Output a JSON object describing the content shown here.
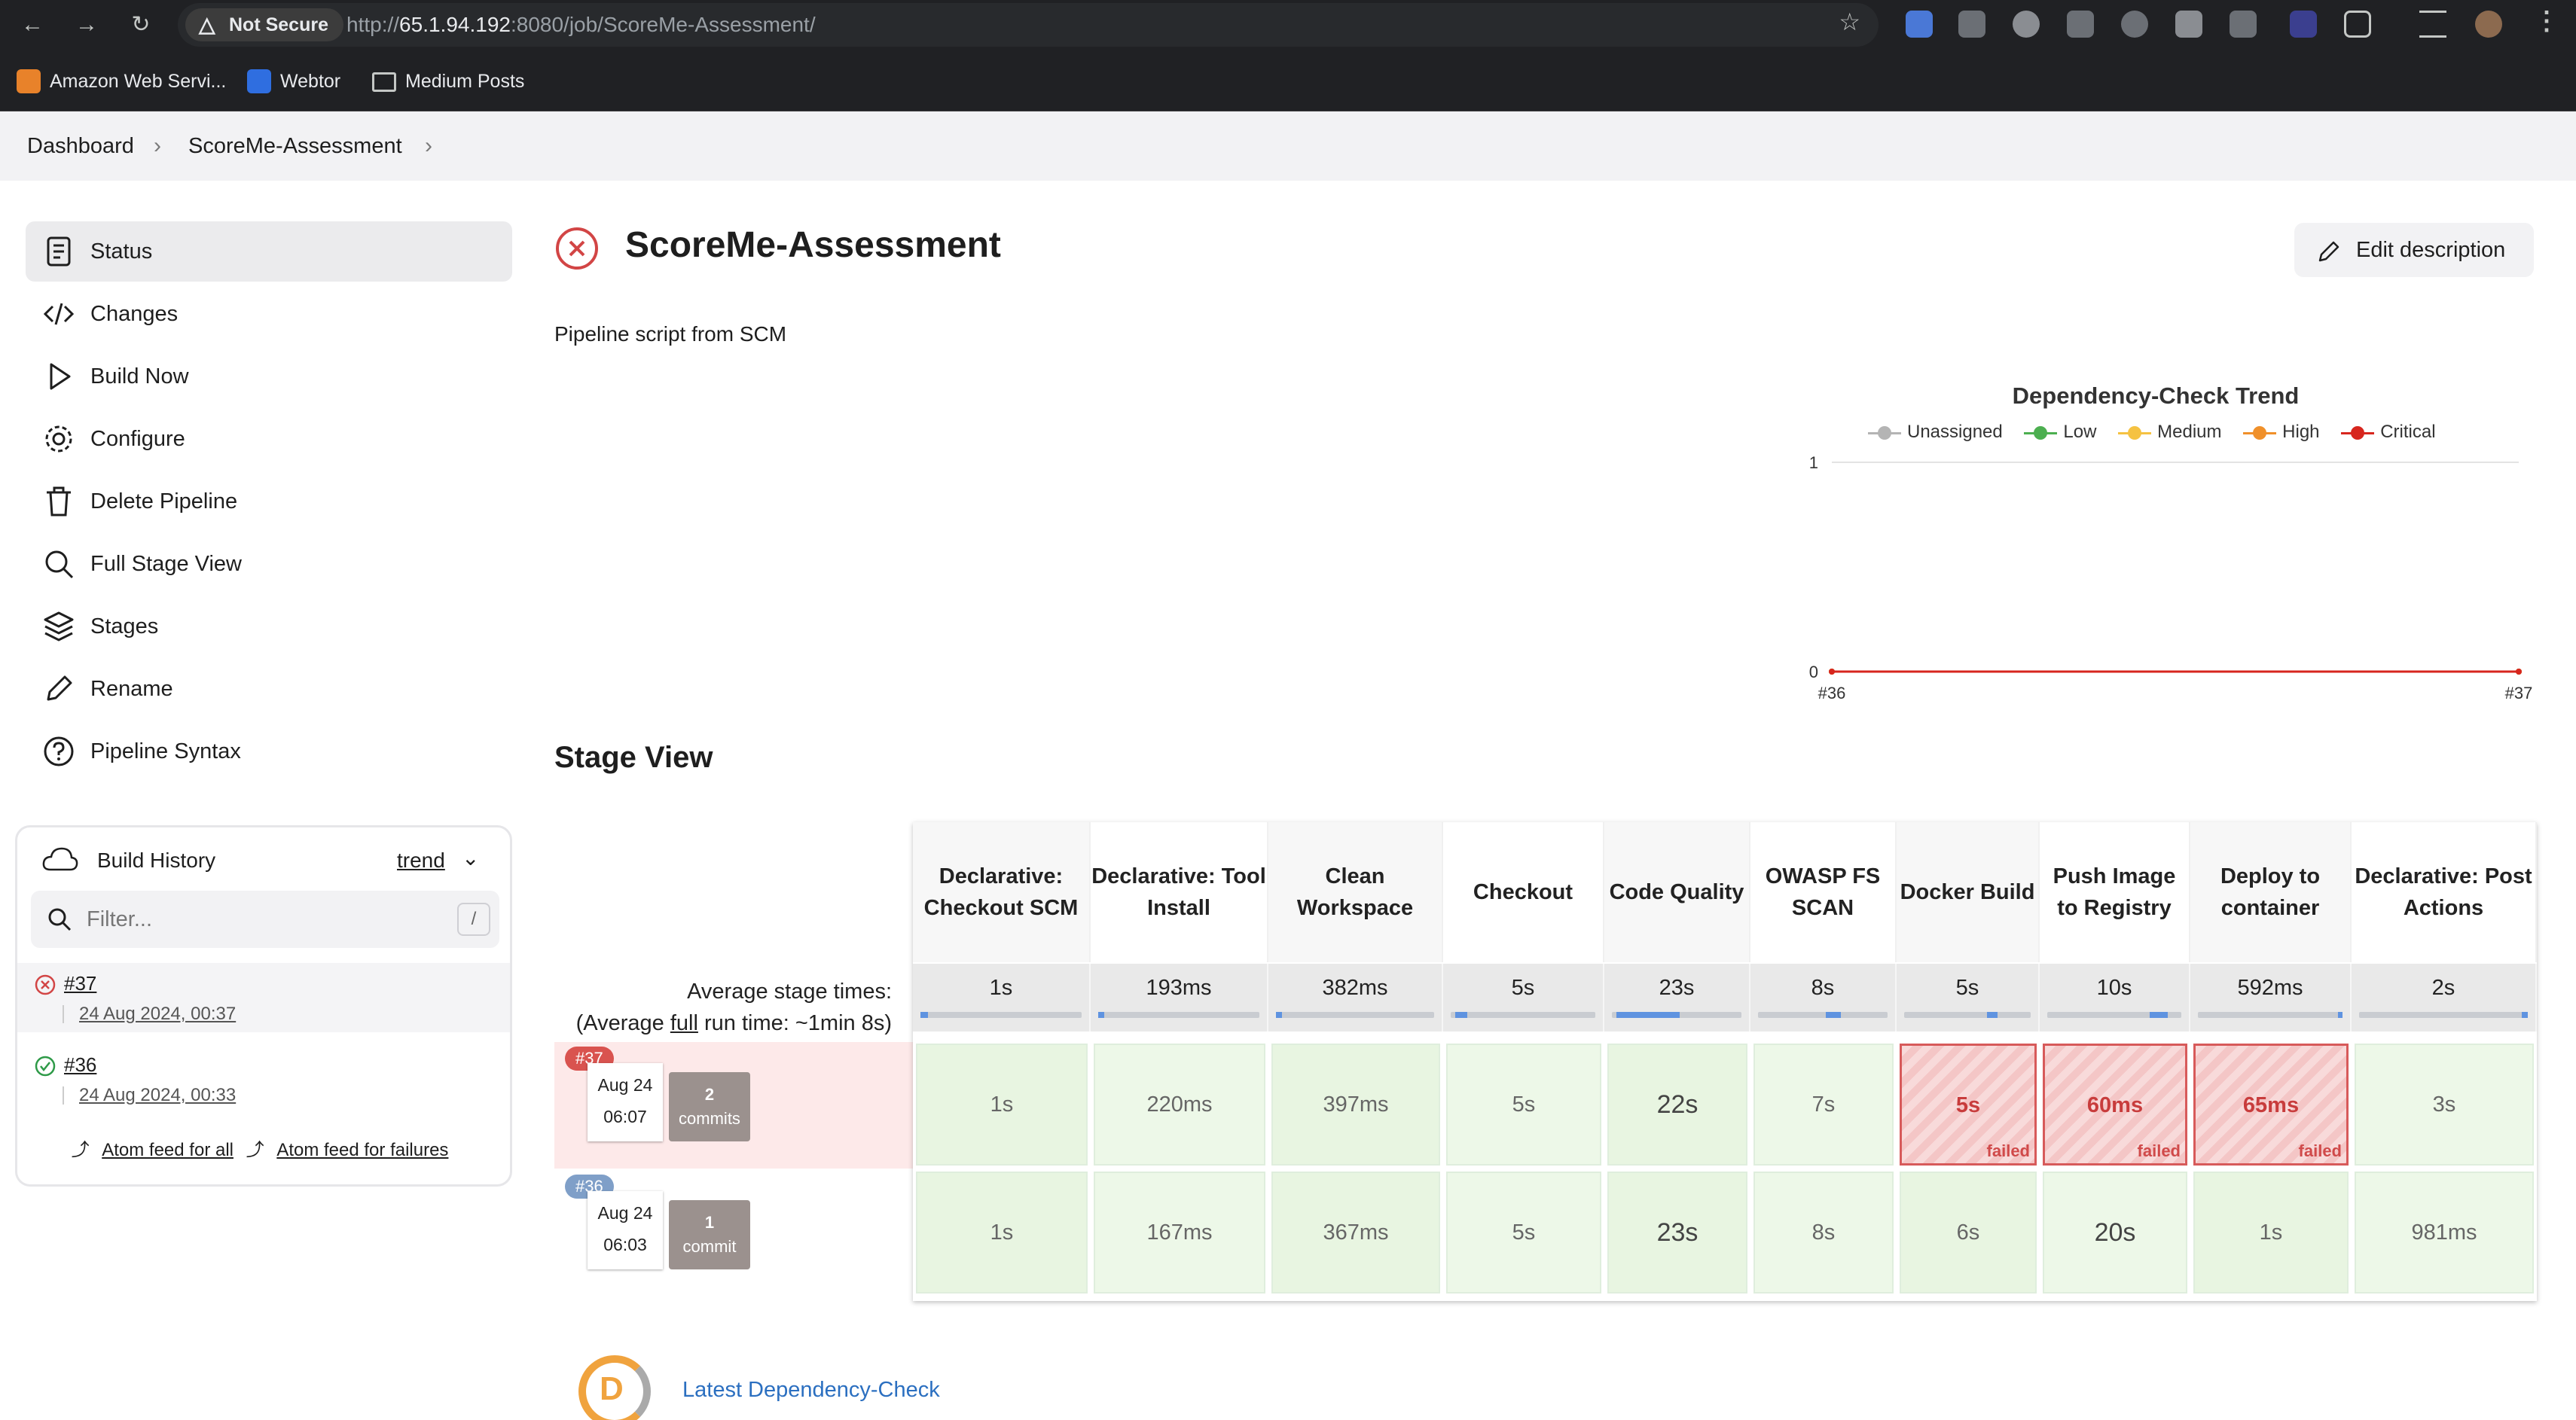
{
  "browser": {
    "security_chip": "Not Secure",
    "url_prefix": "http://",
    "url_host": "65.1.94.192",
    "url_rest": ":8080/job/ScoreMe-Assessment/",
    "bookmarks": [
      "Amazon Web Servi...",
      "Webtor",
      "Medium Posts"
    ]
  },
  "breadcrumb": [
    "Dashboard",
    "ScoreMe-Assessment"
  ],
  "sidebar": {
    "tasks": [
      {
        "label": "Status",
        "icon": "document-icon"
      },
      {
        "label": "Changes",
        "icon": "code-icon"
      },
      {
        "label": "Build Now",
        "icon": "play-icon"
      },
      {
        "label": "Configure",
        "icon": "gear-icon"
      },
      {
        "label": "Delete Pipeline",
        "icon": "trash-icon"
      },
      {
        "label": "Full Stage View",
        "icon": "search-icon"
      },
      {
        "label": "Stages",
        "icon": "layers-icon"
      },
      {
        "label": "Rename",
        "icon": "pencil-icon"
      },
      {
        "label": "Pipeline Syntax",
        "icon": "help-icon"
      }
    ]
  },
  "build_history": {
    "title": "Build History",
    "trend_label": "trend",
    "filter_placeholder": "Filter...",
    "filter_shortcut": "/",
    "builds": [
      {
        "number": "#37",
        "date": "24 Aug 2024, 00:37",
        "status": "failed"
      },
      {
        "number": "#36",
        "date": "24 Aug 2024, 00:33",
        "status": "success"
      }
    ],
    "feed_all": "Atom feed for all",
    "feed_failures": "Atom feed for failures"
  },
  "job": {
    "title": "ScoreMe-Assessment",
    "edit_description": "Edit description",
    "description": "Pipeline script from SCM"
  },
  "trend_chart": {
    "title": "Dependency-Check Trend",
    "legend": [
      {
        "name": "Unassigned",
        "color": "#b4b4b4"
      },
      {
        "name": "Low",
        "color": "#4caf50"
      },
      {
        "name": "Medium",
        "color": "#f5c242"
      },
      {
        "name": "High",
        "color": "#f0902a"
      },
      {
        "name": "Critical",
        "color": "#d7261e"
      }
    ],
    "y_ticks": [
      "1",
      "0"
    ],
    "x_ticks": [
      "#36",
      "#37"
    ]
  },
  "chart_data": {
    "type": "line",
    "title": "Dependency-Check Trend",
    "x": [
      "#36",
      "#37"
    ],
    "series": [
      {
        "name": "Unassigned",
        "values": [
          0,
          0
        ]
      },
      {
        "name": "Low",
        "values": [
          0,
          0
        ]
      },
      {
        "name": "Medium",
        "values": [
          0,
          0
        ]
      },
      {
        "name": "High",
        "values": [
          0,
          0
        ]
      },
      {
        "name": "Critical",
        "values": [
          0,
          0
        ]
      }
    ],
    "ylim": [
      0,
      1
    ],
    "legend_position": "top"
  },
  "stage_view": {
    "title": "Stage View",
    "avg_label_line1": "Average stage times:",
    "avg_label_line2_pre": "(Average ",
    "avg_label_full": "full",
    "avg_label_line2_post": " run time: ~1min 8s)",
    "stages": [
      {
        "name": "Declarative: Checkout SCM",
        "avg": "1s"
      },
      {
        "name": "Declarative: Tool Install",
        "avg": "193ms"
      },
      {
        "name": "Clean Workspace",
        "avg": "382ms"
      },
      {
        "name": "Checkout",
        "avg": "5s"
      },
      {
        "name": "Code Quality",
        "avg": "23s"
      },
      {
        "name": "OWASP FS SCAN",
        "avg": "8s"
      },
      {
        "name": "Docker Build",
        "avg": "5s"
      },
      {
        "name": "Push Image to Registry",
        "avg": "10s"
      },
      {
        "name": "Deploy to container",
        "avg": "592ms"
      },
      {
        "name": "Declarative: Post Actions",
        "avg": "2s"
      }
    ],
    "runs": [
      {
        "badge": "#37",
        "date": "Aug 24",
        "time": "06:07",
        "commits_count": "2",
        "commits_label": "commits",
        "cells": [
          "1s",
          "220ms",
          "397ms",
          "5s",
          "22s",
          "7s",
          "5s",
          "60ms",
          "65ms",
          "3s"
        ],
        "failed_label": "failed"
      },
      {
        "badge": "#36",
        "date": "Aug 24",
        "time": "06:03",
        "commits_count": "1",
        "commits_label": "commit",
        "cells": [
          "1s",
          "167ms",
          "367ms",
          "5s",
          "23s",
          "8s",
          "6s",
          "20s",
          "1s",
          "981ms"
        ]
      }
    ]
  },
  "dependency_check_link": "Latest Dependency-Check"
}
